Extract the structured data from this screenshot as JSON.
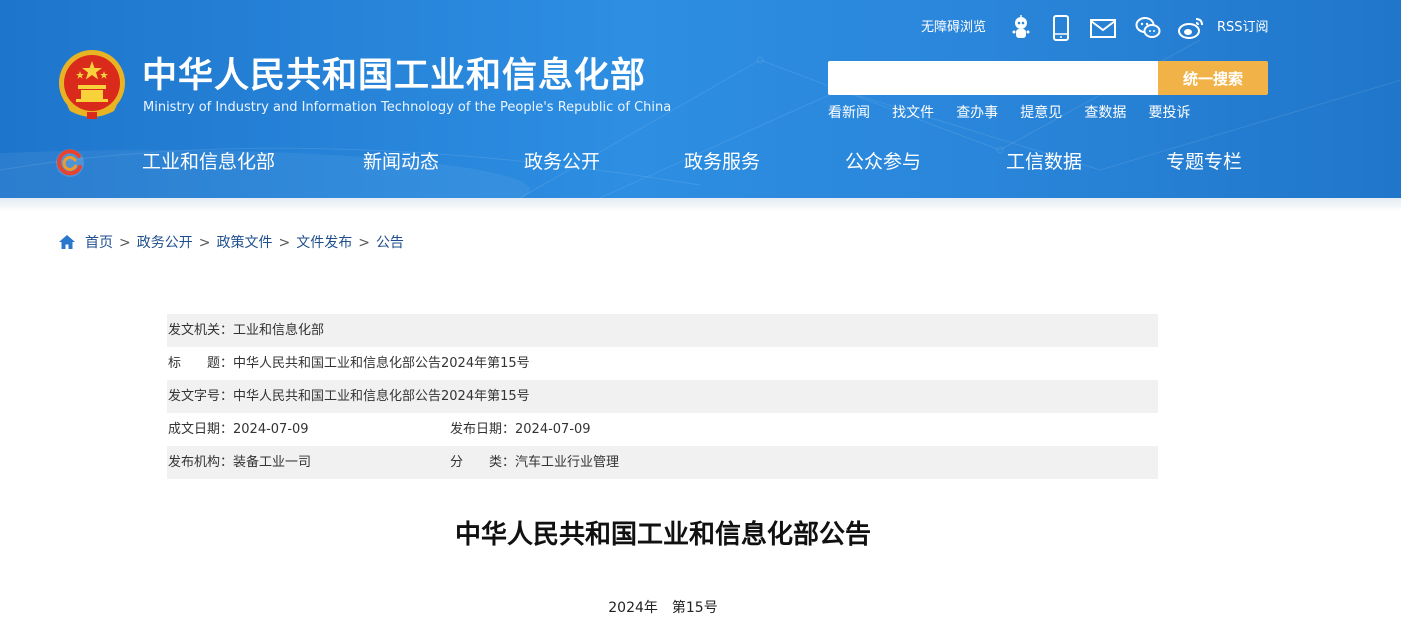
{
  "header": {
    "site_title": "中华人民共和国工业和信息化部",
    "site_subtitle": "Ministry of Industry and Information Technology of the People's Republic of China",
    "emblem_icon": "national-emblem-icon",
    "utility": {
      "accessibility": "无障碍浏览",
      "rss": "RSS订阅",
      "icons": [
        "robot-assistant-icon",
        "mobile-icon",
        "mail-icon",
        "wechat-icon",
        "weibo-icon"
      ]
    },
    "search": {
      "placeholder": "",
      "button_label": "统一搜索"
    },
    "quick_links": [
      "看新闻",
      "找文件",
      "查办事",
      "提意见",
      "查数据",
      "要投诉"
    ],
    "nav": [
      "工业和信息化部",
      "新闻动态",
      "政务公开",
      "政务服务",
      "公众参与",
      "工信数据",
      "专题专栏"
    ]
  },
  "breadcrumb": [
    "首页",
    "政务公开",
    "政策文件",
    "文件发布",
    "公告"
  ],
  "breadcrumb_separator": ">",
  "info": {
    "issuer": "发文机关：工业和信息化部",
    "title": "标　　题：中华人民共和国工业和信息化部公告2024年第15号",
    "doc_number": "发文字号：中华人民共和国工业和信息化部公告2024年第15号",
    "created_date": "成文日期：2024-07-09",
    "published_date": "发布日期：2024-07-09",
    "publisher": "发布机构：装备工业一司",
    "category": "分　　类：汽车工业行业管理"
  },
  "document": {
    "title": "中华人民共和国工业和信息化部公告",
    "number": "2024年　第15号"
  },
  "colors": {
    "header_blue": "#2a86da",
    "search_button": "#f1b347",
    "link_blue": "#1f4f8f"
  }
}
